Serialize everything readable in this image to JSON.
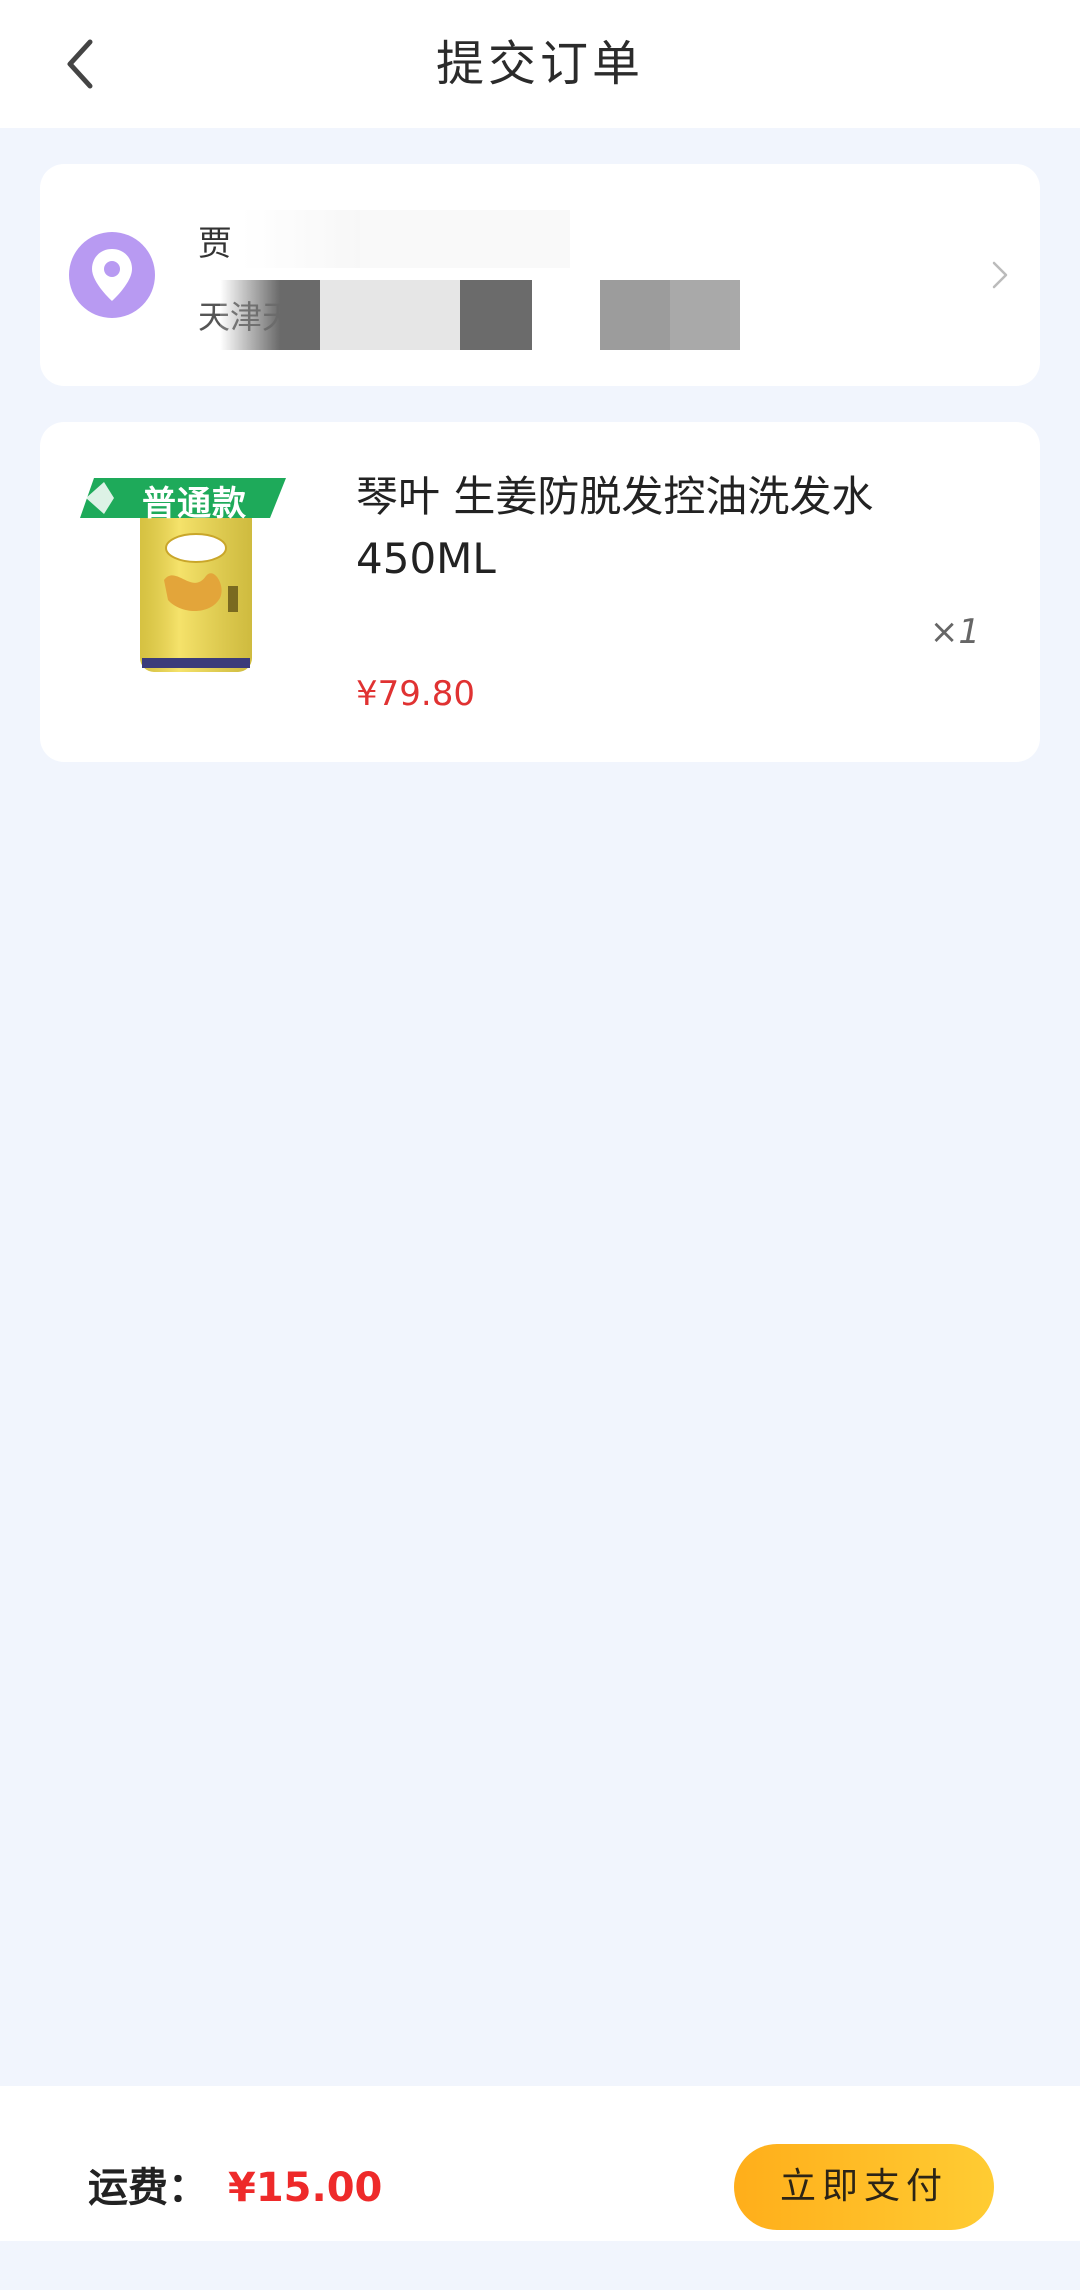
{
  "header": {
    "title": "提交订单",
    "back_icon": "chevron-left-icon"
  },
  "address": {
    "name": "贾",
    "line": "天津天",
    "accent_color": "#b89af2",
    "icon": "location-pin-icon",
    "chevron_icon": "chevron-right-icon"
  },
  "product": {
    "badge": "普通款",
    "name": "琴叶 生姜防脱发控油洗发水450ML",
    "quantity": "×1",
    "price": "¥79.80",
    "price_color": "#e03232"
  },
  "bottom_bar": {
    "shipping_label": "运费：",
    "shipping_value": "¥15.00",
    "pay_button": "立即支付",
    "button_color": "#ffb81f"
  }
}
